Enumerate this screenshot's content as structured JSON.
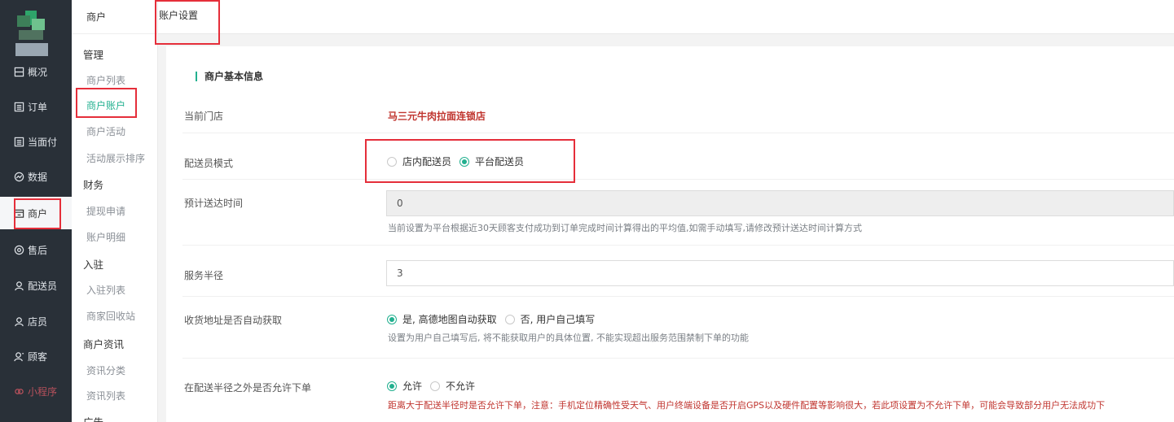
{
  "nav": {
    "items": [
      {
        "label": "概况",
        "icon": "dashboard-icon"
      },
      {
        "label": "订单",
        "icon": "list-icon"
      },
      {
        "label": "当面付",
        "icon": "list-icon"
      },
      {
        "label": "数据",
        "icon": "chart-icon"
      },
      {
        "label": "商户",
        "icon": "shop-icon"
      },
      {
        "label": "售后",
        "icon": "service-icon"
      },
      {
        "label": "配送员",
        "icon": "person-icon"
      },
      {
        "label": "店员",
        "icon": "person-icon"
      },
      {
        "label": "顾客",
        "icon": "person-icon"
      },
      {
        "label": "小程序",
        "icon": "miniapp-icon"
      }
    ]
  },
  "submenu": {
    "header": "商户",
    "groups": {
      "manage": "管理",
      "finance": "财务",
      "entry": "入驻",
      "news": "商户资讯",
      "ads": "广告"
    },
    "items": {
      "merchant_list": "商户列表",
      "merchant_account": "商户账户",
      "merchant_activity": "商户活动",
      "activity_sort": "活动展示排序",
      "withdraw": "提现申请",
      "account_detail": "账户明细",
      "entry_list": "入驻列表",
      "recycle": "商家回收站",
      "news_category": "资讯分类",
      "news_list": "资讯列表"
    }
  },
  "tab": {
    "label": "账户设置"
  },
  "form": {
    "section_title": "商户基本信息",
    "current_store_label": "当前门店",
    "current_store_value": "马三元牛肉拉面连锁店",
    "delivery_mode_label": "配送员模式",
    "delivery_mode_options": [
      "店内配送员",
      "平台配送员"
    ],
    "delivery_mode_selected": "平台配送员",
    "eta_label": "预计送达时间",
    "eta_value": "0",
    "eta_hint": "当前设置为平台根据近30天顾客支付成功到订单完成时间计算得出的平均值,如需手动填写,请修改预计送达时间计算方式",
    "radius_label": "服务半径",
    "radius_value": "3",
    "auto_addr_label": "收货地址是否自动获取",
    "auto_addr_options": [
      "是, 高德地图自动获取",
      "否, 用户自己填写"
    ],
    "auto_addr_selected": "是, 高德地图自动获取",
    "auto_addr_hint": "设置为用户自己填写后, 将不能获取用户的具体位置, 不能实现超出服务范围禁制下单的功能",
    "outside_label": "在配送半径之外是否允许下单",
    "outside_options": [
      "允许",
      "不允许"
    ],
    "outside_selected": "允许",
    "outside_hint": "距离大于配送半径时是否允许下单，注意：手机定位精确性受天气、用户终端设备是否开启GPS以及硬件配置等影响很大，若此项设置为不允许下单，可能会导致部分用户无法成功下"
  },
  "colors": {
    "accent": "#22b08f",
    "nav_bg": "#293038",
    "highlight_box": "#e52e3a",
    "store_name": "#c0352f"
  }
}
